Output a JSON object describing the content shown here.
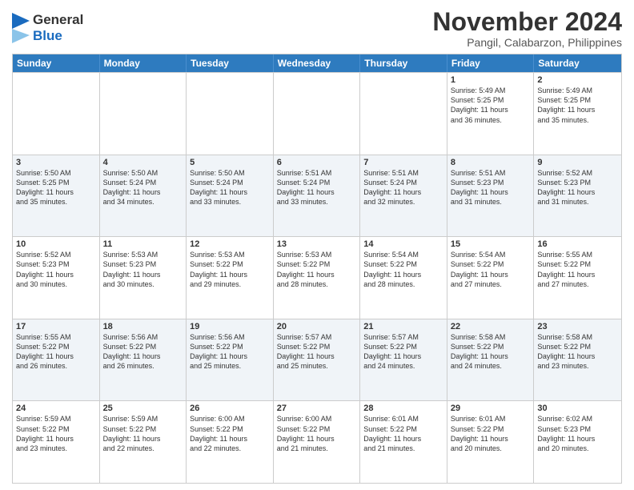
{
  "header": {
    "logo_line1": "General",
    "logo_line2": "Blue",
    "month_title": "November 2024",
    "location": "Pangil, Calabarzon, Philippines"
  },
  "calendar": {
    "days_of_week": [
      "Sunday",
      "Monday",
      "Tuesday",
      "Wednesday",
      "Thursday",
      "Friday",
      "Saturday"
    ],
    "rows": [
      {
        "alt": false,
        "cells": [
          {
            "day": "",
            "detail": ""
          },
          {
            "day": "",
            "detail": ""
          },
          {
            "day": "",
            "detail": ""
          },
          {
            "day": "",
            "detail": ""
          },
          {
            "day": "",
            "detail": ""
          },
          {
            "day": "1",
            "detail": "Sunrise: 5:49 AM\nSunset: 5:25 PM\nDaylight: 11 hours\nand 36 minutes."
          },
          {
            "day": "2",
            "detail": "Sunrise: 5:49 AM\nSunset: 5:25 PM\nDaylight: 11 hours\nand 35 minutes."
          }
        ]
      },
      {
        "alt": true,
        "cells": [
          {
            "day": "3",
            "detail": "Sunrise: 5:50 AM\nSunset: 5:25 PM\nDaylight: 11 hours\nand 35 minutes."
          },
          {
            "day": "4",
            "detail": "Sunrise: 5:50 AM\nSunset: 5:24 PM\nDaylight: 11 hours\nand 34 minutes."
          },
          {
            "day": "5",
            "detail": "Sunrise: 5:50 AM\nSunset: 5:24 PM\nDaylight: 11 hours\nand 33 minutes."
          },
          {
            "day": "6",
            "detail": "Sunrise: 5:51 AM\nSunset: 5:24 PM\nDaylight: 11 hours\nand 33 minutes."
          },
          {
            "day": "7",
            "detail": "Sunrise: 5:51 AM\nSunset: 5:24 PM\nDaylight: 11 hours\nand 32 minutes."
          },
          {
            "day": "8",
            "detail": "Sunrise: 5:51 AM\nSunset: 5:23 PM\nDaylight: 11 hours\nand 31 minutes."
          },
          {
            "day": "9",
            "detail": "Sunrise: 5:52 AM\nSunset: 5:23 PM\nDaylight: 11 hours\nand 31 minutes."
          }
        ]
      },
      {
        "alt": false,
        "cells": [
          {
            "day": "10",
            "detail": "Sunrise: 5:52 AM\nSunset: 5:23 PM\nDaylight: 11 hours\nand 30 minutes."
          },
          {
            "day": "11",
            "detail": "Sunrise: 5:53 AM\nSunset: 5:23 PM\nDaylight: 11 hours\nand 30 minutes."
          },
          {
            "day": "12",
            "detail": "Sunrise: 5:53 AM\nSunset: 5:22 PM\nDaylight: 11 hours\nand 29 minutes."
          },
          {
            "day": "13",
            "detail": "Sunrise: 5:53 AM\nSunset: 5:22 PM\nDaylight: 11 hours\nand 28 minutes."
          },
          {
            "day": "14",
            "detail": "Sunrise: 5:54 AM\nSunset: 5:22 PM\nDaylight: 11 hours\nand 28 minutes."
          },
          {
            "day": "15",
            "detail": "Sunrise: 5:54 AM\nSunset: 5:22 PM\nDaylight: 11 hours\nand 27 minutes."
          },
          {
            "day": "16",
            "detail": "Sunrise: 5:55 AM\nSunset: 5:22 PM\nDaylight: 11 hours\nand 27 minutes."
          }
        ]
      },
      {
        "alt": true,
        "cells": [
          {
            "day": "17",
            "detail": "Sunrise: 5:55 AM\nSunset: 5:22 PM\nDaylight: 11 hours\nand 26 minutes."
          },
          {
            "day": "18",
            "detail": "Sunrise: 5:56 AM\nSunset: 5:22 PM\nDaylight: 11 hours\nand 26 minutes."
          },
          {
            "day": "19",
            "detail": "Sunrise: 5:56 AM\nSunset: 5:22 PM\nDaylight: 11 hours\nand 25 minutes."
          },
          {
            "day": "20",
            "detail": "Sunrise: 5:57 AM\nSunset: 5:22 PM\nDaylight: 11 hours\nand 25 minutes."
          },
          {
            "day": "21",
            "detail": "Sunrise: 5:57 AM\nSunset: 5:22 PM\nDaylight: 11 hours\nand 24 minutes."
          },
          {
            "day": "22",
            "detail": "Sunrise: 5:58 AM\nSunset: 5:22 PM\nDaylight: 11 hours\nand 24 minutes."
          },
          {
            "day": "23",
            "detail": "Sunrise: 5:58 AM\nSunset: 5:22 PM\nDaylight: 11 hours\nand 23 minutes."
          }
        ]
      },
      {
        "alt": false,
        "cells": [
          {
            "day": "24",
            "detail": "Sunrise: 5:59 AM\nSunset: 5:22 PM\nDaylight: 11 hours\nand 23 minutes."
          },
          {
            "day": "25",
            "detail": "Sunrise: 5:59 AM\nSunset: 5:22 PM\nDaylight: 11 hours\nand 22 minutes."
          },
          {
            "day": "26",
            "detail": "Sunrise: 6:00 AM\nSunset: 5:22 PM\nDaylight: 11 hours\nand 22 minutes."
          },
          {
            "day": "27",
            "detail": "Sunrise: 6:00 AM\nSunset: 5:22 PM\nDaylight: 11 hours\nand 21 minutes."
          },
          {
            "day": "28",
            "detail": "Sunrise: 6:01 AM\nSunset: 5:22 PM\nDaylight: 11 hours\nand 21 minutes."
          },
          {
            "day": "29",
            "detail": "Sunrise: 6:01 AM\nSunset: 5:22 PM\nDaylight: 11 hours\nand 20 minutes."
          },
          {
            "day": "30",
            "detail": "Sunrise: 6:02 AM\nSunset: 5:23 PM\nDaylight: 11 hours\nand 20 minutes."
          }
        ]
      }
    ]
  }
}
